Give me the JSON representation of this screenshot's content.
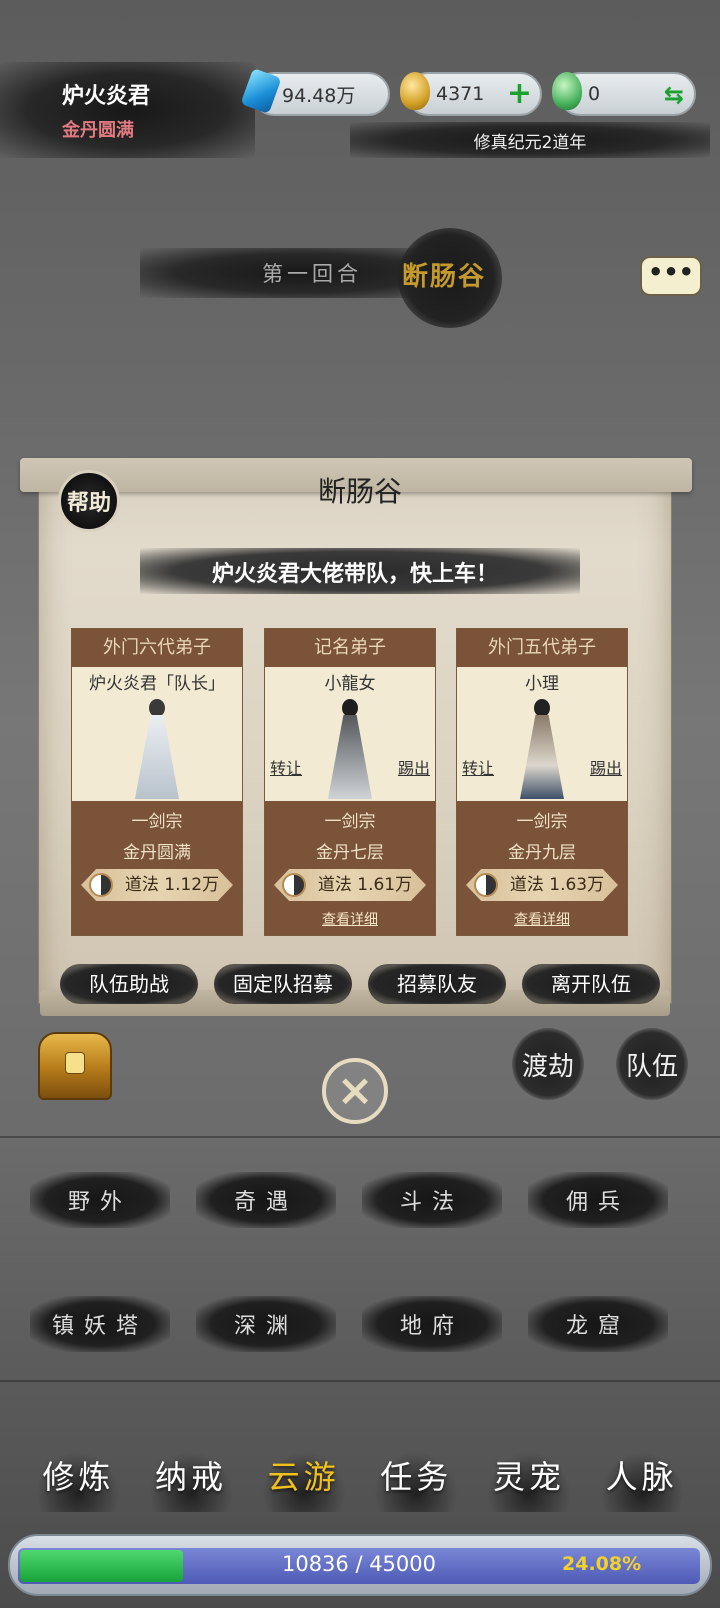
{
  "player": {
    "name": "炉火炎君",
    "rank": "金丹圆满"
  },
  "resources": {
    "spirit_stone": "94.48万",
    "gold": "4371",
    "jade": "0"
  },
  "era": "修真纪元2道年",
  "stage": {
    "round": "第一回合",
    "location": "断肠谷"
  },
  "panel": {
    "help": "帮助",
    "title": "断肠谷",
    "banner": "炉火炎君大佬带队，快上车！",
    "members": [
      {
        "role": "外门六代弟子",
        "name": "炉火炎君「队长」",
        "sect": "一剑宗",
        "realm": "金丹圆满",
        "dao": "道法 1.12万"
      },
      {
        "role": "记名弟子",
        "name": "小龍女",
        "transfer": "转让",
        "kick": "踢出",
        "sect": "一剑宗",
        "realm": "金丹七层",
        "dao": "道法 1.61万",
        "detail": "查看详细"
      },
      {
        "role": "外门五代弟子",
        "name": "小理",
        "transfer": "转让",
        "kick": "踢出",
        "sect": "一剑宗",
        "realm": "金丹九层",
        "dao": "道法 1.63万",
        "detail": "查看详细"
      }
    ],
    "actions": [
      "队伍助战",
      "固定队招募",
      "招募队友",
      "离开队伍"
    ]
  },
  "side_buttons": {
    "tribulation": "渡劫",
    "team": "队伍"
  },
  "menu": [
    "野外",
    "奇遇",
    "斗法",
    "佣兵",
    "镇妖塔",
    "深渊",
    "地府",
    "龙窟"
  ],
  "tabs": [
    {
      "label": "修炼",
      "active": false
    },
    {
      "label": "纳戒",
      "active": false
    },
    {
      "label": "云游",
      "active": true
    },
    {
      "label": "任务",
      "active": false
    },
    {
      "label": "灵宠",
      "active": false
    },
    {
      "label": "人脉",
      "active": false
    }
  ],
  "experience": {
    "text": "10836 / 45000",
    "percent": "24.08%",
    "progress": 0.2408
  },
  "colors": {
    "active_tab": "#f2c21c",
    "card_brown": "#7a5338",
    "xp_green": "#18a23a",
    "xp_blue": "#4e5bb5"
  },
  "icons": {
    "spirit_stone": "gem-icon",
    "gold": "gourd-icon",
    "jade": "jade-icon",
    "add": "plus-icon",
    "exchange": "swap-icon",
    "chat": "chat-icon",
    "close": "close-icon",
    "treasure": "chest-icon",
    "dao": "taiji-icon"
  }
}
